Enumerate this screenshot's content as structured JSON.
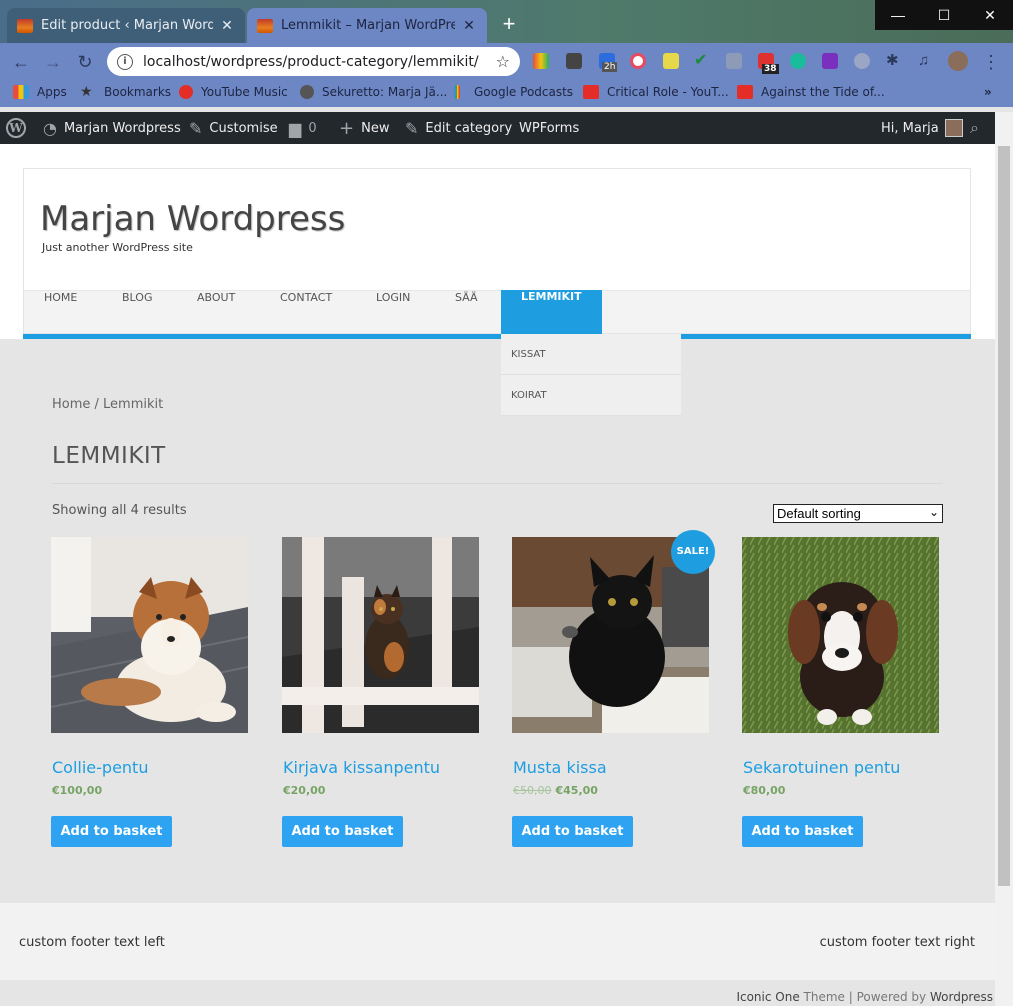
{
  "browser": {
    "tabs": [
      {
        "title": "Edit product ‹ Marjan Wordpress",
        "active": false
      },
      {
        "title": "Lemmikit – Marjan WordPress",
        "active": true
      }
    ],
    "new_tab_icon": "plus-icon",
    "url": "localhost/wordpress/product-category/lemmikit/",
    "extension_badges": {
      "timer": "2h",
      "todo": "38"
    },
    "bookmarks": [
      {
        "label": "Apps",
        "icon": "apps-grid-icon"
      },
      {
        "label": "Bookmarks",
        "icon": "star-icon"
      },
      {
        "label": "YouTube Music",
        "icon": "youtube-music-icon"
      },
      {
        "label": "Sekuretto: Marja Jä...",
        "icon": "globe-icon"
      },
      {
        "label": "Google Podcasts",
        "icon": "podcasts-icon"
      },
      {
        "label": "Critical Role - YouT...",
        "icon": "youtube-icon"
      },
      {
        "label": "Against the Tide of...",
        "icon": "youtube-icon"
      }
    ],
    "more_bookmarks": "»"
  },
  "adminbar": {
    "site_name": "Marjan Wordpress",
    "customise": "Customise",
    "comments_count": "0",
    "new": "New",
    "edit_category": "Edit category",
    "wpforms": "WPForms",
    "greeting": "Hi, Marja"
  },
  "site": {
    "title": "Marjan Wordpress",
    "tagline": "Just another WordPress site"
  },
  "menu": {
    "items": [
      "HOME",
      "BLOG",
      "ABOUT",
      "CONTACT",
      "LOGIN",
      "SÄÄ",
      "LEMMIKIT"
    ],
    "active": "LEMMIKIT",
    "submenu": [
      "KISSAT",
      "KOIRAT"
    ]
  },
  "shop": {
    "breadcrumb": "Home / Lemmikit",
    "page_title": "LEMMIKIT",
    "result_count": "Showing all 4 results",
    "sorting": "Default sorting",
    "sale_badge": "SALE!",
    "add_label": "Add to basket",
    "products": [
      {
        "name": "Collie-pentu",
        "price": "€100,00",
        "old_price": ""
      },
      {
        "name": "Kirjava kissanpentu",
        "price": "€20,00",
        "old_price": ""
      },
      {
        "name": "Musta kissa",
        "price": "€45,00",
        "old_price": "€50,00"
      },
      {
        "name": "Sekarotuinen pentu",
        "price": "€80,00",
        "old_price": ""
      }
    ]
  },
  "footer": {
    "left": "custom footer text left",
    "right": "custom footer text right",
    "credits_theme": "Iconic One",
    "credits_mid1": " Theme | Powered by ",
    "credits_wp": "Wordpress"
  },
  "colors": {
    "accent": "#1e9ee0",
    "button": "#2ea3f2",
    "price": "#77a464",
    "adminbar": "#23282d"
  }
}
